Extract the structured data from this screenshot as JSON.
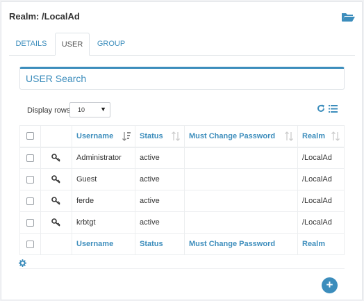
{
  "realm": {
    "title": "Realm: /LocalAd"
  },
  "icons": {
    "folder": "folder-open-icon",
    "refresh": "refresh-icon",
    "columns": "list-icon",
    "settings": "gear-icon",
    "key": "key-icon",
    "add": "plus-icon",
    "sort": "sort-icon"
  },
  "colors": {
    "accent": "#3c8dbc",
    "text": "#333333"
  },
  "tabs": [
    {
      "label": "DETAILS",
      "active": false
    },
    {
      "label": "USER",
      "active": true
    },
    {
      "label": "GROUP",
      "active": false
    }
  ],
  "search": {
    "title": "USER Search"
  },
  "display_rows": {
    "label": "Display rows",
    "value": "10"
  },
  "table": {
    "columns": [
      "Username",
      "Status",
      "Must Change Password",
      "Realm"
    ],
    "rows": [
      {
        "username": "Administrator",
        "status": "active",
        "must_change_password": "",
        "realm": "/LocalAd"
      },
      {
        "username": "Guest",
        "status": "active",
        "must_change_password": "",
        "realm": "/LocalAd"
      },
      {
        "username": "ferde",
        "status": "active",
        "must_change_password": "",
        "realm": "/LocalAd"
      },
      {
        "username": "krbtgt",
        "status": "active",
        "must_change_password": "",
        "realm": "/LocalAd"
      }
    ],
    "footer": [
      "Username",
      "Status",
      "Must Change Password",
      "Realm"
    ]
  },
  "add_button": {
    "label": "+"
  }
}
